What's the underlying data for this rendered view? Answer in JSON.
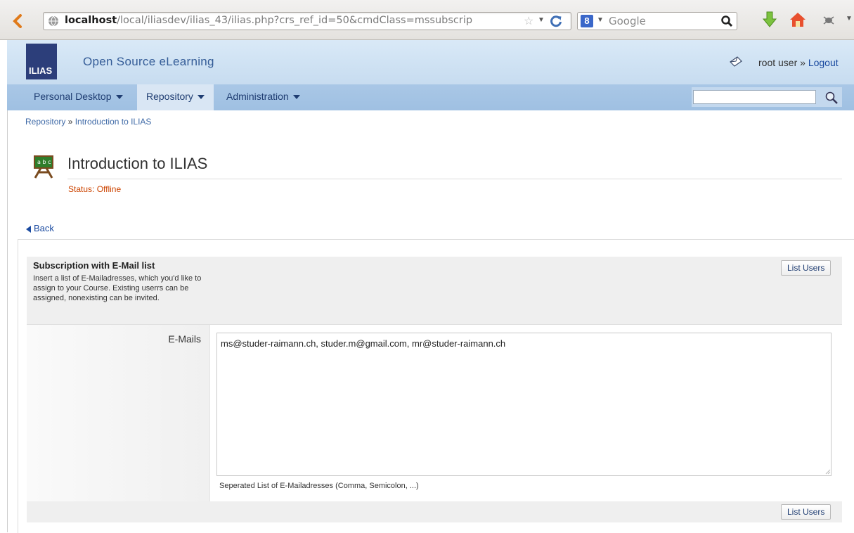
{
  "browser": {
    "url_host": "localhost",
    "url_rest": "/local/iliasdev/ilias_43/ilias.php?crs_ref_id=50&cmdClass=mssubscrip",
    "search_engine": "Google",
    "search_engine_badge": "8"
  },
  "header": {
    "logo_text": "ILIAS",
    "site_title": "Open Source eLearning",
    "user_name": "root user",
    "user_sep": " » ",
    "logout_label": "Logout"
  },
  "mainmenu": {
    "items": [
      {
        "label": "Personal Desktop"
      },
      {
        "label": "Repository"
      },
      {
        "label": "Administration"
      }
    ],
    "search_value": ""
  },
  "breadcrumb": {
    "items": [
      "Repository",
      "Introduction to ILIAS"
    ],
    "sep": " » "
  },
  "page": {
    "title": "Introduction to ILIAS",
    "status": "Status: Offline",
    "back_label": "Back"
  },
  "form": {
    "title": "Subscription with E-Mail list",
    "description": "Insert a list of E-Mailadresses, which you'd like to assign to your Course. Existing userrs can be assigned, nonexisting can be invited.",
    "top_button": "List Users",
    "bottom_button": "List Users",
    "field_label": "E-Mails",
    "field_value": "ms@studer-raimann.ch, studer.m@gmail.com, mr@studer-raimann.ch",
    "field_info": "Seperated List of E-Mailadresses (Comma, Semicolon, ...)"
  },
  "icons": {
    "back": "back-arrow-icon",
    "globe": "globe-icon",
    "bookmark": "star-icon",
    "reload": "reload-icon",
    "search": "search-icon",
    "download": "download-icon",
    "home": "home-icon",
    "addon": "bug-icon",
    "mail": "mail-icon",
    "course": "course-icon"
  },
  "colors": {
    "header_bg": "#d9e9f7",
    "menu_bg": "#a9c7e6",
    "link": "#1a4aa0",
    "status": "#cc4400"
  }
}
